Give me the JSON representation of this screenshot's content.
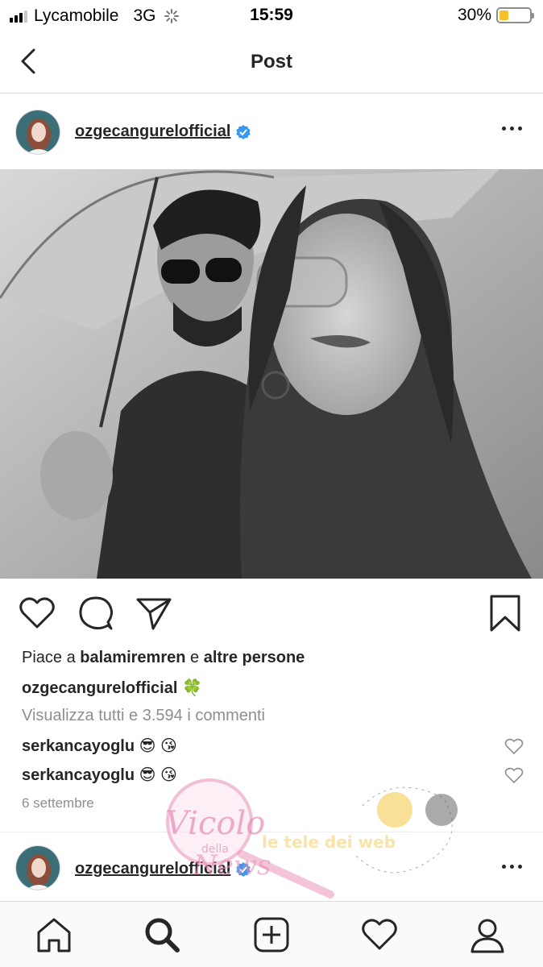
{
  "status_bar": {
    "carrier": "Lycamobile",
    "network": "3G",
    "time": "15:59",
    "battery_percent": "30%",
    "battery_level": 0.3
  },
  "nav": {
    "title": "Post",
    "back_icon": "chevron-left-icon"
  },
  "post": {
    "username": "ozgecangurelofficial",
    "verified_icon": "verified-badge-icon",
    "more_icon": "more-horizontal-icon",
    "photo_alt_icon": "photo",
    "actions": [
      "heart-icon",
      "comment-icon",
      "share-icon",
      "bookmark-icon"
    ],
    "likes": {
      "prefix": "Piace a",
      "user": "balamiremren",
      "middle": "e",
      "suffix": "altre persone"
    },
    "caption": {
      "username": "ozgecangurelofficial",
      "text": "🍀"
    },
    "view_all_comments": "Visualizza tutti e 3.594 i commenti",
    "comments": [
      {
        "username": "serkancayoglu",
        "text": "😎 😘"
      },
      {
        "username": "serkancayoglu",
        "text": "😎 😘"
      }
    ],
    "date": "6 settembre"
  },
  "next_post": {
    "username": "ozgecangurelofficial"
  },
  "watermark": {
    "line1": "Vicolo",
    "line2": "della",
    "line3": "News",
    "tagline": "le tele dei web"
  },
  "tabbar": [
    "home-icon",
    "search-icon",
    "new-post-icon",
    "activity-heart-icon",
    "profile-icon"
  ],
  "colors": {
    "verified": "#3897f0",
    "battery": "#f5c12b",
    "text": "#262626",
    "muted": "#8e8e8e"
  }
}
